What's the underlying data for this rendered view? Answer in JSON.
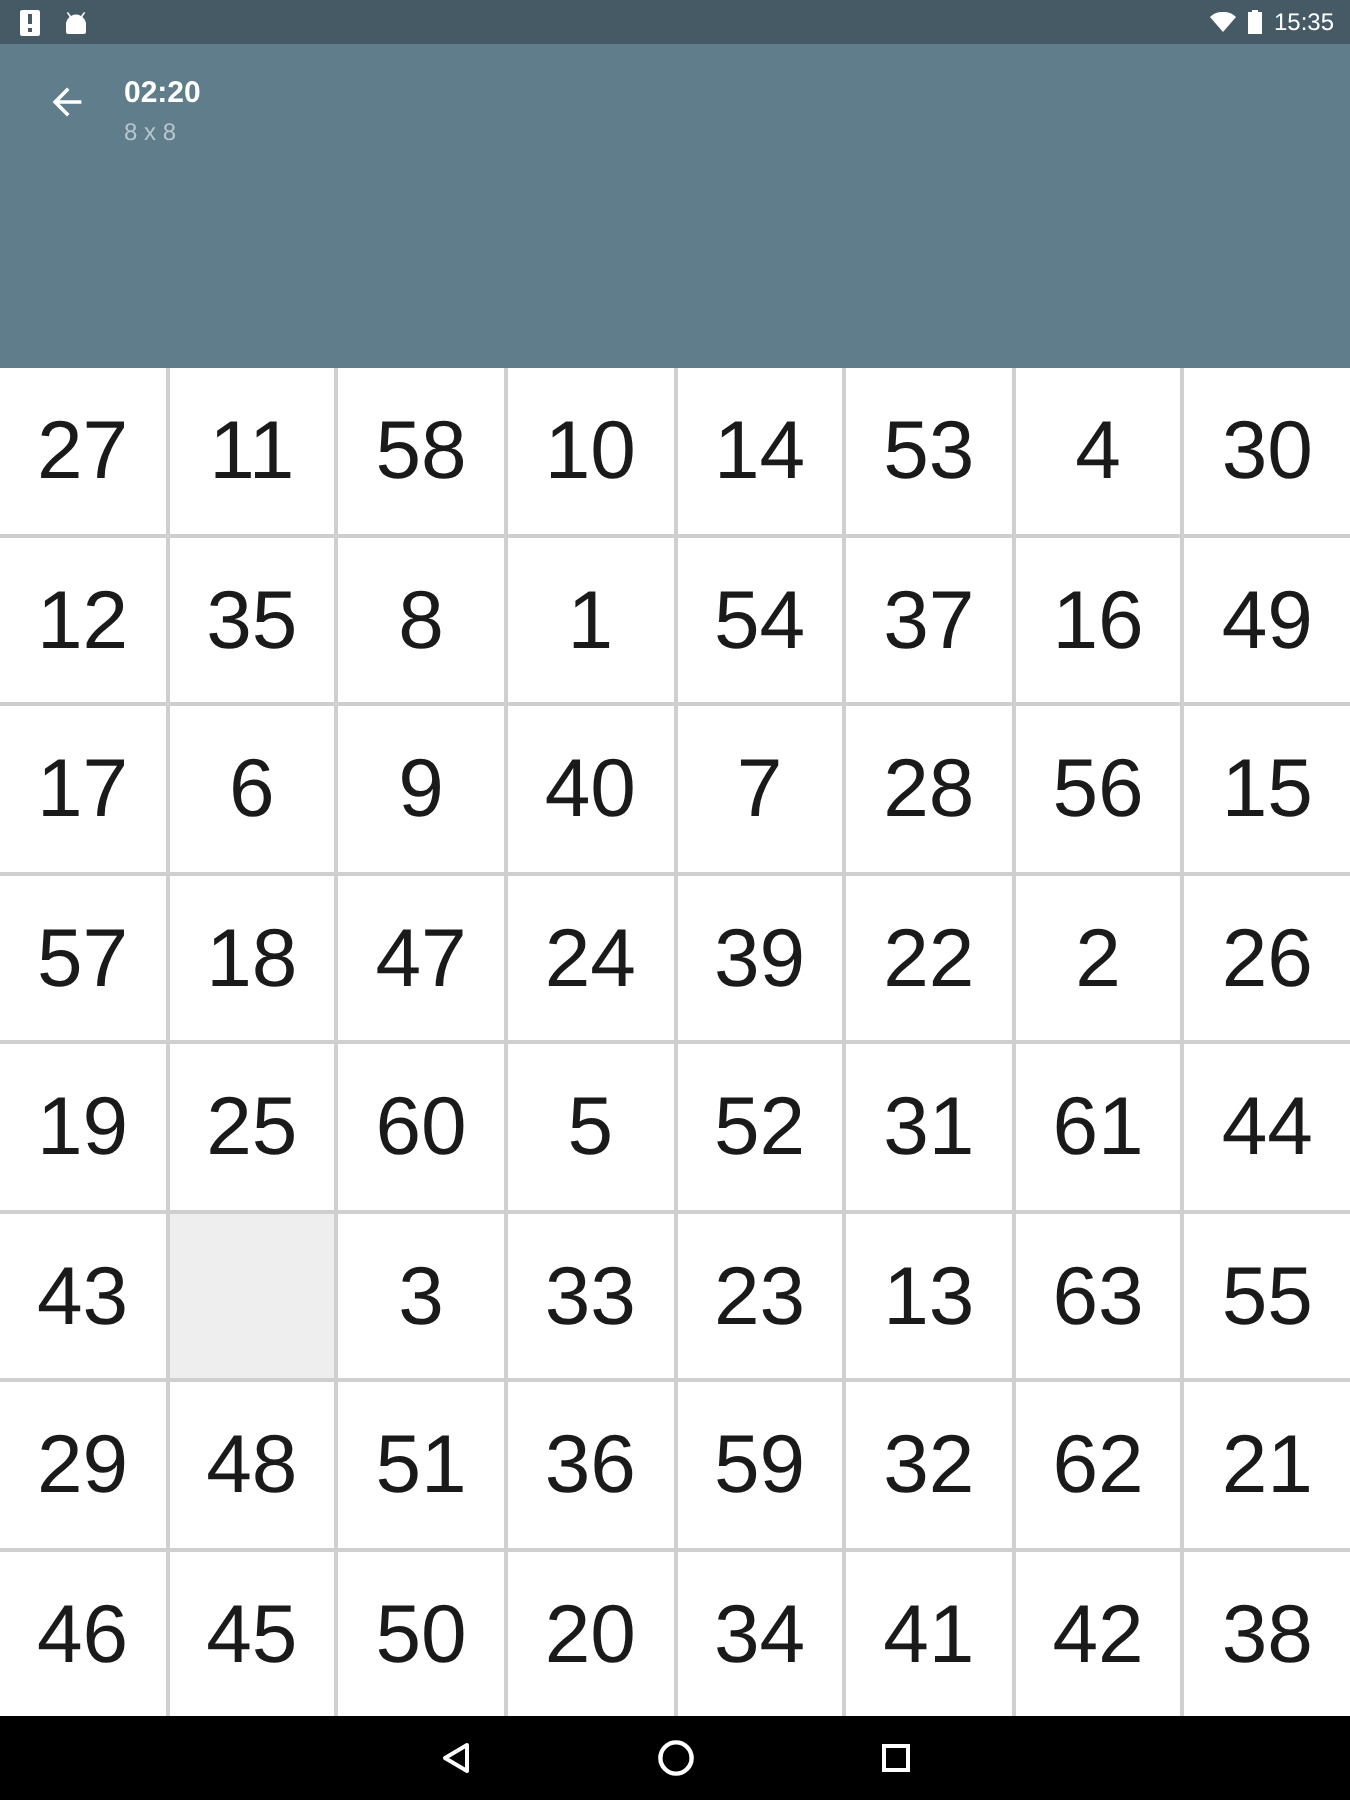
{
  "status_bar": {
    "time": "15:35"
  },
  "app_bar": {
    "title": "02:20",
    "subtitle": "8 x 8"
  },
  "board": {
    "tiles": [
      {
        "kind": "number",
        "label": "27"
      },
      {
        "kind": "number",
        "label": "11"
      },
      {
        "kind": "number",
        "label": "58"
      },
      {
        "kind": "number",
        "label": "10"
      },
      {
        "kind": "number",
        "label": "14"
      },
      {
        "kind": "number",
        "label": "53"
      },
      {
        "kind": "number",
        "label": "4"
      },
      {
        "kind": "number",
        "label": "30"
      },
      {
        "kind": "number",
        "label": "12"
      },
      {
        "kind": "number",
        "label": "35"
      },
      {
        "kind": "number",
        "label": "8"
      },
      {
        "kind": "number",
        "label": "1"
      },
      {
        "kind": "number",
        "label": "54"
      },
      {
        "kind": "number",
        "label": "37"
      },
      {
        "kind": "number",
        "label": "16"
      },
      {
        "kind": "number",
        "label": "49"
      },
      {
        "kind": "number",
        "label": "17"
      },
      {
        "kind": "number",
        "label": "6"
      },
      {
        "kind": "number",
        "label": "9"
      },
      {
        "kind": "number",
        "label": "40"
      },
      {
        "kind": "number",
        "label": "7"
      },
      {
        "kind": "number",
        "label": "28"
      },
      {
        "kind": "number",
        "label": "56"
      },
      {
        "kind": "number",
        "label": "15"
      },
      {
        "kind": "number",
        "label": "57"
      },
      {
        "kind": "number",
        "label": "18"
      },
      {
        "kind": "number",
        "label": "47"
      },
      {
        "kind": "number",
        "label": "24"
      },
      {
        "kind": "number",
        "label": "39"
      },
      {
        "kind": "number",
        "label": "22"
      },
      {
        "kind": "number",
        "label": "2"
      },
      {
        "kind": "number",
        "label": "26"
      },
      {
        "kind": "number",
        "label": "19"
      },
      {
        "kind": "number",
        "label": "25"
      },
      {
        "kind": "number",
        "label": "60"
      },
      {
        "kind": "number",
        "label": "5"
      },
      {
        "kind": "number",
        "label": "52"
      },
      {
        "kind": "number",
        "label": "31"
      },
      {
        "kind": "number",
        "label": "61"
      },
      {
        "kind": "number",
        "label": "44"
      },
      {
        "kind": "number",
        "label": "43"
      },
      {
        "kind": "blank"
      },
      {
        "kind": "number",
        "label": "3"
      },
      {
        "kind": "number",
        "label": "33"
      },
      {
        "kind": "number",
        "label": "23"
      },
      {
        "kind": "number",
        "label": "13"
      },
      {
        "kind": "number",
        "label": "63"
      },
      {
        "kind": "number",
        "label": "55"
      },
      {
        "kind": "number",
        "label": "29"
      },
      {
        "kind": "number",
        "label": "48"
      },
      {
        "kind": "number",
        "label": "51"
      },
      {
        "kind": "number",
        "label": "36"
      },
      {
        "kind": "number",
        "label": "59"
      },
      {
        "kind": "number",
        "label": "32"
      },
      {
        "kind": "number",
        "label": "62"
      },
      {
        "kind": "number",
        "label": "21"
      },
      {
        "kind": "number",
        "label": "46"
      },
      {
        "kind": "number",
        "label": "45"
      },
      {
        "kind": "number",
        "label": "50"
      },
      {
        "kind": "number",
        "label": "20"
      },
      {
        "kind": "number",
        "label": "34"
      },
      {
        "kind": "number",
        "label": "41"
      },
      {
        "kind": "number",
        "label": "42"
      },
      {
        "kind": "number",
        "label": "38"
      }
    ]
  }
}
